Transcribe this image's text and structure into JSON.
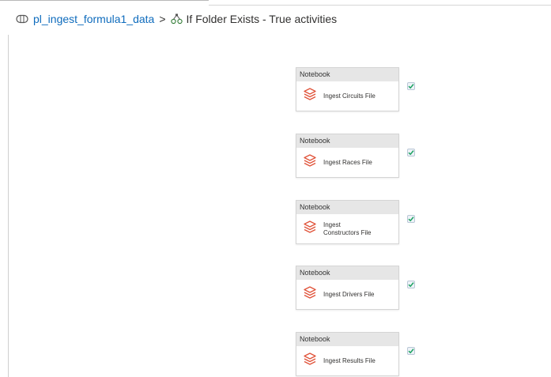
{
  "breadcrumb": {
    "pipeline_name": "pl_ingest_formula1_data",
    "separator": ">",
    "current": "If Folder Exists - True activities",
    "pipeline_icon": "pipeline-icon",
    "condition_icon": "if-condition-icon"
  },
  "activities": [
    {
      "type": "Notebook",
      "name": "Ingest Circuits File",
      "status_icon": "success-check-icon"
    },
    {
      "type": "Notebook",
      "name": "Ingest Races File",
      "status_icon": "success-check-icon"
    },
    {
      "type": "Notebook",
      "name": "Ingest Constructors File",
      "status_icon": "success-check-icon"
    },
    {
      "type": "Notebook",
      "name": "Ingest Drivers File",
      "status_icon": "success-check-icon"
    },
    {
      "type": "Notebook",
      "name": "Ingest Results File",
      "status_icon": "success-check-icon"
    }
  ],
  "colors": {
    "link": "#0f6cbd",
    "notebook_icon": "#e0533a",
    "success": "#1ba160"
  }
}
